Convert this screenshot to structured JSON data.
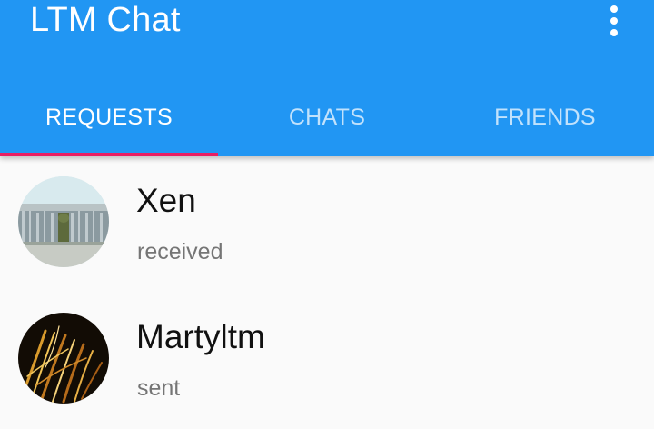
{
  "app": {
    "title": "LTM Chat",
    "colors": {
      "primary": "#2196f3",
      "accent_indicator": "#e91e63",
      "background": "#fafafa"
    },
    "overflow_icon": "more-vert-icon"
  },
  "tabs": [
    {
      "label": "REQUESTS",
      "selected": true
    },
    {
      "label": "CHATS",
      "selected": false
    },
    {
      "label": "FRIENDS",
      "selected": false
    }
  ],
  "requests": [
    {
      "name": "Xen",
      "status": "received",
      "avatar": "fountain-photo"
    },
    {
      "name": "Martyltm",
      "status": "sent",
      "avatar": "light-streaks-photo"
    }
  ]
}
